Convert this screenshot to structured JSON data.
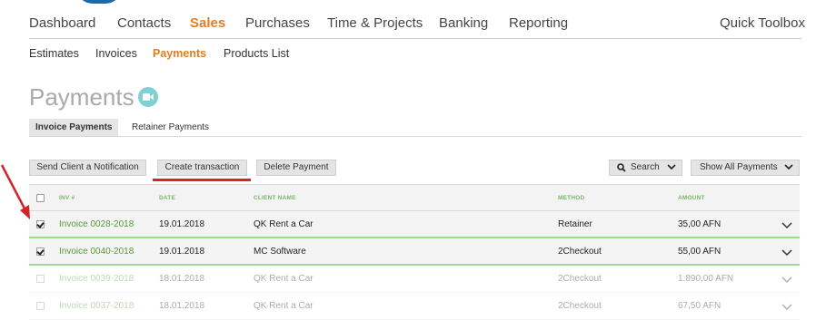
{
  "nav": {
    "items": [
      "Dashboard",
      "Contacts",
      "Sales",
      "Purchases",
      "Time & Projects",
      "Banking",
      "Reporting"
    ],
    "active": "Sales",
    "quick_toolbox": "Quick Toolbox"
  },
  "subnav": {
    "items": [
      "Estimates",
      "Invoices",
      "Payments",
      "Products List"
    ],
    "active": "Payments"
  },
  "page": {
    "title": "Payments",
    "video_icon": "video-camera-icon"
  },
  "tabs": {
    "items": [
      "Invoice Payments",
      "Retainer Payments"
    ],
    "active": "Invoice Payments"
  },
  "toolbar": {
    "send_notification": "Send Client a Notification",
    "create_transaction": "Create transaction",
    "delete_payment": "Delete Payment",
    "search": "Search",
    "show_all": "Show All Payments"
  },
  "table": {
    "headers": [
      "INV #",
      "DATE",
      "CLIENT NAME",
      "METHOD",
      "AMOUNT"
    ],
    "rows": [
      {
        "inv": "Invoice 0028-2018",
        "date": "19.01.2018",
        "client": "QK Rent a Car",
        "method": "Retainer",
        "amount": "35,00 AFN",
        "checked": true
      },
      {
        "inv": "Invoice 0040-2018",
        "date": "19.01.2018",
        "client": "MC Software",
        "method": "2Checkout",
        "amount": "55,00 AFN",
        "checked": true
      },
      {
        "inv": "Invoice 0039-2018",
        "date": "18.01.2018",
        "client": "QK Rent a Car",
        "method": "2Checkout",
        "amount": "1.890,00 AFN",
        "checked": false
      },
      {
        "inv": "Invoice 0037-2018",
        "date": "18.01.2018",
        "client": "QK Rent a Car",
        "method": "2Checkout",
        "amount": "67,50 AFN",
        "checked": false
      }
    ]
  },
  "colors": {
    "accent": "#e57c1f",
    "link_green": "#5a9a3a",
    "header_green": "#7ab56a",
    "annotation_red": "#d1242b"
  }
}
